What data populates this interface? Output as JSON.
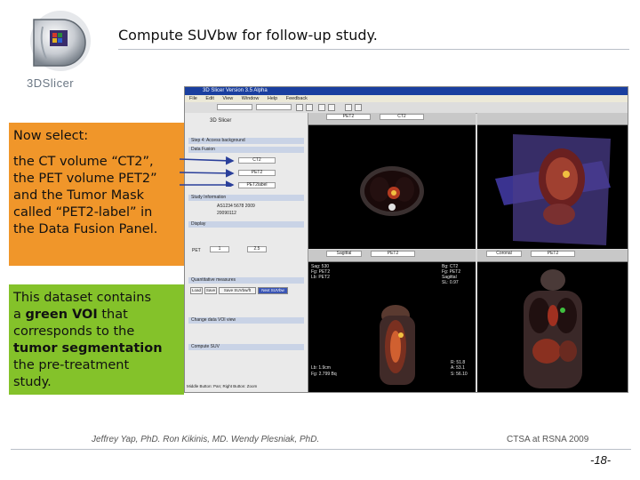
{
  "header": {
    "logo_text": "3DSlicer",
    "title": "Compute SUVbw for follow-up study."
  },
  "callouts": {
    "select": {
      "lines": [
        "Now select:",
        "",
        "the CT volume “CT2”,",
        "the PET volume PET2”",
        "and the Tumor Mask",
        "called “PET2-label” in",
        "the Data Fusion Panel."
      ],
      "color": "#f0962a"
    },
    "dataset": {
      "part1": "This dataset contains",
      "part2": "a ",
      "bold1": "green VOI",
      "part3": " that",
      "part4": "corresponds to the",
      "bold2": "tumor segmentation",
      "part5": "the pre-treatment",
      "part6": "study.",
      "color": "#84c22a"
    }
  },
  "slicer": {
    "window_title": "3D Slicer Version 3.5 Alpha",
    "menu": [
      "File",
      "Edit",
      "View",
      "Window",
      "Help",
      "Feedback"
    ],
    "panel": {
      "brand": "3D Slicer",
      "sections": [
        "Step 4: Access background",
        "Data Fusion",
        "Study Information",
        "Display",
        "Quantitative measures",
        "Change data VOI view",
        "Compute SUV"
      ],
      "ct_volume": "CT2",
      "pet_volume": "PET2",
      "mask_volume": "PET2label",
      "patient_name": "AS1234 5678 2009",
      "study_date": "20090112",
      "pet_window": "PET",
      "window_min": "1",
      "window_max": "2.5",
      "buttons": [
        "Load",
        "Save",
        "Save SUVbw/ft",
        "Next SUVbw"
      ],
      "status": "Middle Button: Pan; Right Button: Zoom"
    },
    "viewers": {
      "top_left_label": "Red",
      "top_left_fg": "PET2",
      "top_left_bg": "CT2",
      "bottom_left_label": "Sagittal",
      "bottom_left_fg": "PET2",
      "bottom_left_bg": "CT2",
      "bottom_right_label": "Coronal",
      "bottom_right_fg": "PET2",
      "bottom_right_bg": "CT2",
      "sag_overlay_tl": [
        "Sag: 530",
        "Fg: PET2",
        "Lb: PET2"
      ],
      "sag_overlay_tr": [
        "Bg: CT2",
        "Fg: PET2",
        "Sagittal",
        "SL: 0.97"
      ],
      "sag_overlay_bl": [
        "Lb: 1.9cm",
        "Fg: 2.799 Bq"
      ],
      "sag_overlay_br": [
        "R: 51.8",
        "A: 53.1",
        "S: 56.10"
      ]
    }
  },
  "footer": {
    "authors": "Jeffrey Yap, PhD.   Ron Kikinis, MD.   Wendy Plesniak, PhD.",
    "event": "CTSA at RSNA 2009",
    "page": "-18-"
  }
}
